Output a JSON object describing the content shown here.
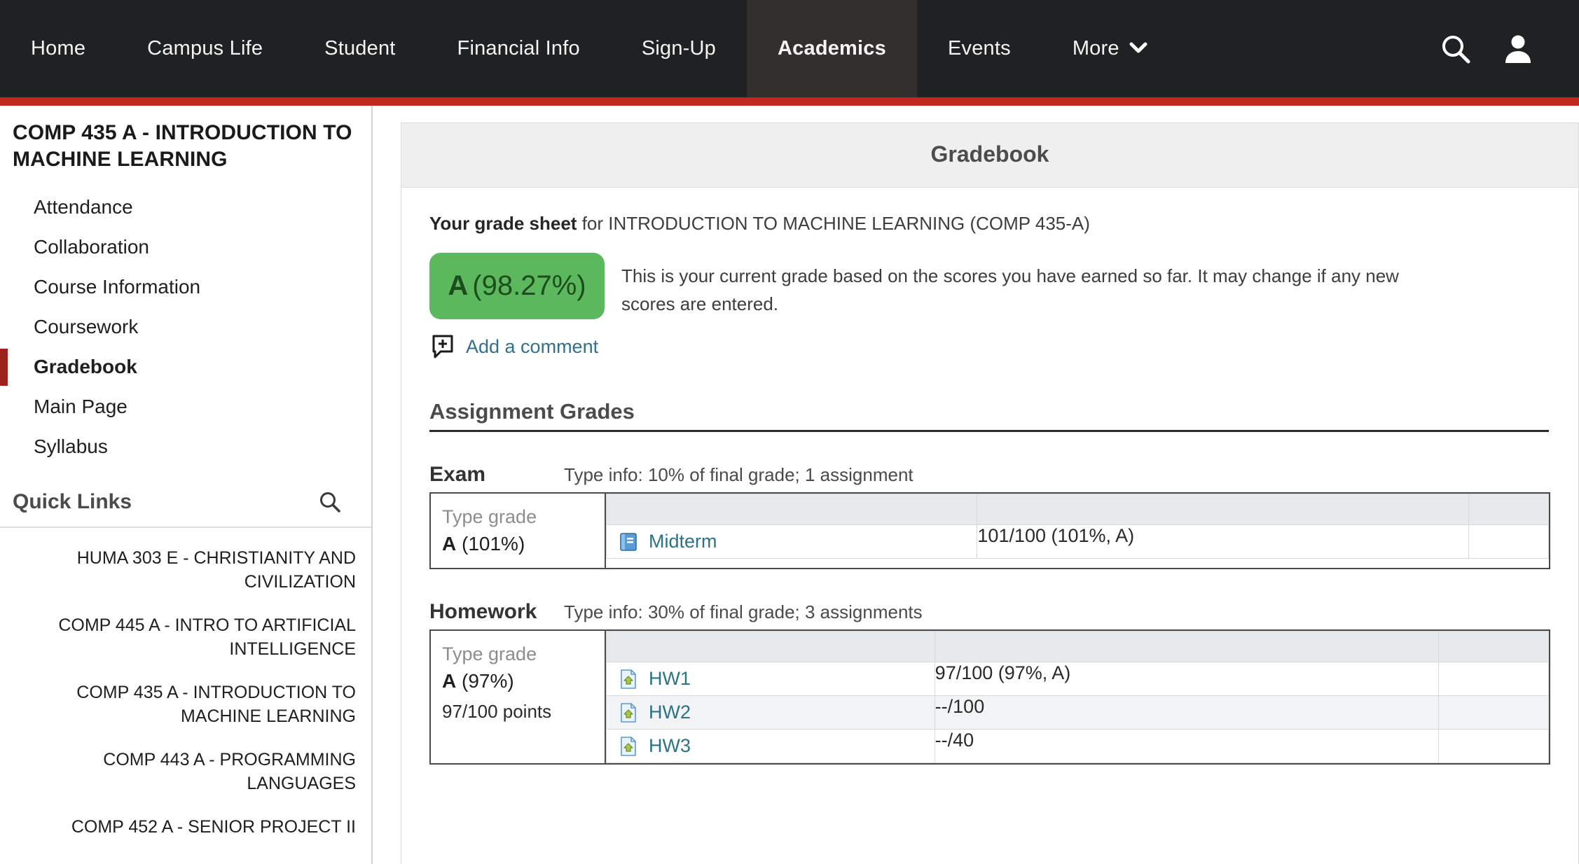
{
  "topnav": {
    "items": [
      {
        "label": "Home",
        "active": false
      },
      {
        "label": "Campus Life",
        "active": false
      },
      {
        "label": "Student",
        "active": false
      },
      {
        "label": "Financial Info",
        "active": false
      },
      {
        "label": "Sign-Up",
        "active": false
      },
      {
        "label": "Academics",
        "active": true
      },
      {
        "label": "Events",
        "active": false
      }
    ],
    "more_label": "More",
    "more_caret": "∨",
    "search_icon": "search-icon",
    "account_icon": "user-account-icon",
    "background_color": "#1f2123",
    "active_background_color": "#332f2e",
    "accent_bar_color": "#c0271f"
  },
  "sidebar": {
    "course_title": "COMP 435 A - INTRODUCTION TO MACHINE LEARNING",
    "links": [
      {
        "label": "Attendance",
        "current": false
      },
      {
        "label": "Collaboration",
        "current": false
      },
      {
        "label": "Course Information",
        "current": false
      },
      {
        "label": "Coursework",
        "current": false
      },
      {
        "label": "Gradebook",
        "current": true
      },
      {
        "label": "Main Page",
        "current": false
      },
      {
        "label": "Syllabus",
        "current": false
      }
    ],
    "current_marker_color": "#9c231c",
    "quick_links": {
      "title": "Quick Links",
      "search_icon": "search-icon",
      "items": [
        "HUMA 303 E - CHRISTIANITY AND CIVILIZATION",
        "COMP 445 A - INTRO TO ARTIFICIAL INTELLIGENCE",
        "COMP 435 A - INTRODUCTION TO MACHINE LEARNING",
        "COMP 443 A - PROGRAMMING LANGUAGES",
        "COMP 452 A - SENIOR PROJECT II"
      ]
    }
  },
  "main": {
    "panel_title": "Gradebook",
    "sheet_label_bold": "Your grade sheet",
    "sheet_label_rest": " for INTRODUCTION TO MACHINE LEARNING (COMP 435-A)",
    "overall_grade": {
      "letter": "A",
      "percent": "(98.27%)",
      "badge_color": "#5cb85c",
      "text_color": "#1d4d1f"
    },
    "grade_note": "This is your current grade based on the scores you have earned so far. It may change if any new scores are entered.",
    "add_comment": {
      "label": "Add a comment",
      "icon": "add-comment-icon",
      "link_color": "#31708f"
    },
    "assignments_heading": "Assignment Grades",
    "groups": [
      {
        "name": "Exam",
        "info": "Type info: 10% of final grade; 1 assignment",
        "type_grade_label": "Type grade",
        "type_grade_value_letter": "A",
        "type_grade_value_percent": "(101%)",
        "type_grade_points": "",
        "items": [
          {
            "icon": "test-book-icon",
            "name": "Midterm",
            "score": "101/100 (101%, A)",
            "extra": ""
          }
        ]
      },
      {
        "name": "Homework",
        "info": "Type info: 30% of final grade; 3 assignments",
        "type_grade_label": "Type grade",
        "type_grade_value_letter": "A",
        "type_grade_value_percent": "(97%)",
        "type_grade_points": "97/100 points",
        "items": [
          {
            "icon": "assignment-doc-icon",
            "name": "HW1",
            "score": "97/100 (97%, A)",
            "extra": ""
          },
          {
            "icon": "assignment-doc-icon",
            "name": "HW2",
            "score": "--/100",
            "extra": ""
          },
          {
            "icon": "assignment-doc-icon",
            "name": "HW3",
            "score": "--/40",
            "extra": ""
          }
        ]
      }
    ]
  }
}
